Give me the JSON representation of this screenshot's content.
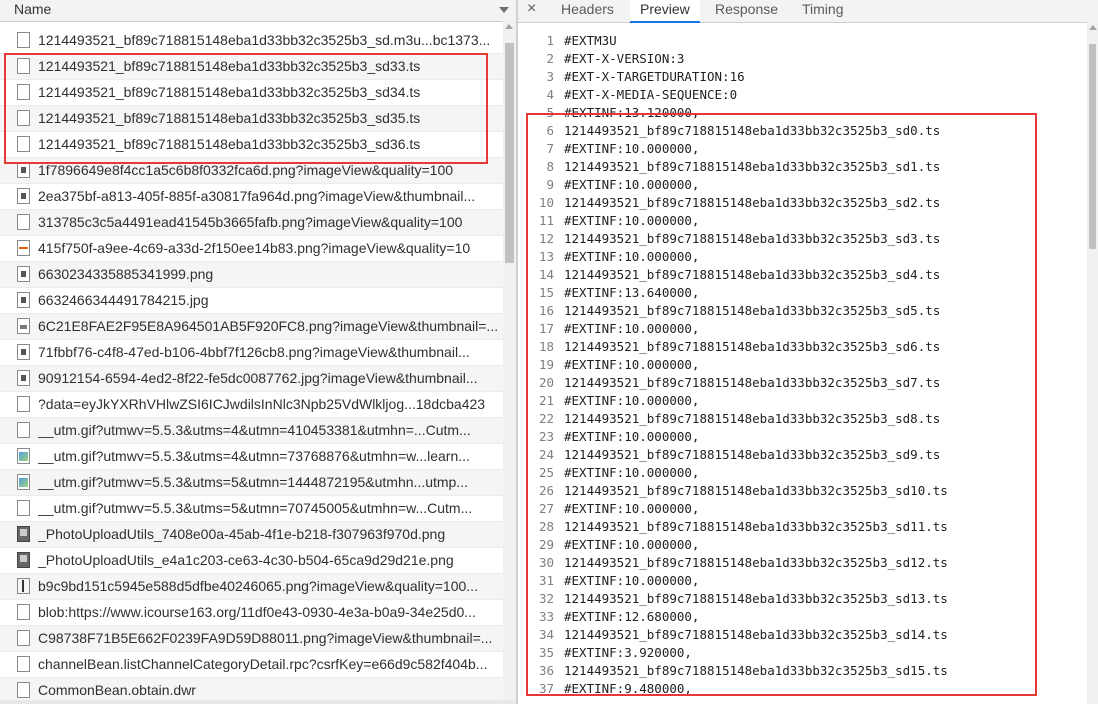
{
  "network": {
    "name_column_label": "Name",
    "requests": [
      {
        "name": "1214493521_bf89c718815148eba1d33bb32c3525b3_sd.m3u...bc1373...",
        "icon": "doc-icon"
      },
      {
        "name": "1214493521_bf89c718815148eba1d33bb32c3525b3_sd33.ts",
        "icon": "doc-icon"
      },
      {
        "name": "1214493521_bf89c718815148eba1d33bb32c3525b3_sd34.ts",
        "icon": "doc-icon"
      },
      {
        "name": "1214493521_bf89c718815148eba1d33bb32c3525b3_sd35.ts",
        "icon": "doc-icon"
      },
      {
        "name": "1214493521_bf89c718815148eba1d33bb32c3525b3_sd36.ts",
        "icon": "doc-icon"
      },
      {
        "name": "1f7896649e8f4cc1a5c6b8f0332fca6d.png?imageView&quality=100",
        "icon": "image-icon"
      },
      {
        "name": "2ea375bf-a813-405f-885f-a30817fa964d.png?imageView&thumbnail...",
        "icon": "image-icon"
      },
      {
        "name": "313785c3c5a4491ead41545b3665fafb.png?imageView&quality=100",
        "icon": "doc-icon"
      },
      {
        "name": "415f750f-a9ee-4c69-a33d-2f150ee14b83.png?imageView&quality=10",
        "icon": "orange-line-icon"
      },
      {
        "name": "6630234335885341999.png",
        "icon": "image-icon"
      },
      {
        "name": "6632466344491784215.jpg",
        "icon": "image-icon"
      },
      {
        "name": "6C21E8FAE2F95E8A964501AB5F920FC8.png?imageView&thumbnail=...",
        "icon": "thumbnail-icon"
      },
      {
        "name": "71fbbf76-c4f8-47ed-b106-4bbf7f126cb8.png?imageView&thumbnail...",
        "icon": "image-icon"
      },
      {
        "name": "90912154-6594-4ed2-8f22-fe5dc0087762.jpg?imageView&thumbnail...",
        "icon": "image-icon"
      },
      {
        "name": "?data=eyJkYXRhVHlwZSI6ICJwdilsInNlc3Npb25VdWlkljog...18dcba423",
        "icon": "doc-icon"
      },
      {
        "name": "__utm.gif?utmwv=5.5.3&utms=4&utmn=410453381&utmhn=...Cutm...",
        "icon": "doc-icon"
      },
      {
        "name": "__utm.gif?utmwv=5.5.3&utms=4&utmn=73768876&utmhn=w...learn...",
        "icon": "gif-icon"
      },
      {
        "name": "__utm.gif?utmwv=5.5.3&utms=5&utmn=1444872195&utmhn...utmp...",
        "icon": "gif-icon"
      },
      {
        "name": "__utm.gif?utmwv=5.5.3&utms=5&utmn=70745005&utmhn=w...Cutm...",
        "icon": "doc-icon"
      },
      {
        "name": "_PhotoUploadUtils_7408e00a-45ab-4f1e-b218-f307963f970d.png",
        "icon": "dark-image-icon"
      },
      {
        "name": "_PhotoUploadUtils_e4a1c203-ce63-4c30-b504-65ca9d29d21e.png",
        "icon": "dark-image-icon"
      },
      {
        "name": "b9c9bd151c5945e588d5dfbe40246065.png?imageView&quality=100...",
        "icon": "ruler-icon"
      },
      {
        "name": "blob:https://www.icourse163.org/11df0e43-0930-4e3a-b0a9-34e25d0...",
        "icon": "doc-icon"
      },
      {
        "name": "C98738F71B5E662F0239FA9D59D88011.png?imageView&thumbnail=...",
        "icon": "doc-icon"
      },
      {
        "name": "channelBean.listChannelCategoryDetail.rpc?csrfKey=e66d9c582f404b...",
        "icon": "doc-icon"
      },
      {
        "name": "CommonBean.obtain.dwr",
        "icon": "doc-icon"
      }
    ]
  },
  "detail": {
    "close_glyph": "×",
    "tabs": [
      "Headers",
      "Preview",
      "Response",
      "Timing"
    ],
    "active_tab": "Preview",
    "lines": [
      {
        "n": "1",
        "t": "#EXTM3U"
      },
      {
        "n": "2",
        "t": "#EXT-X-VERSION:3"
      },
      {
        "n": "3",
        "t": "#EXT-X-TARGETDURATION:16"
      },
      {
        "n": "4",
        "t": "#EXT-X-MEDIA-SEQUENCE:0"
      },
      {
        "n": "5",
        "t": "#EXTINF:13.120000,"
      },
      {
        "n": "6",
        "t": "1214493521_bf89c718815148eba1d33bb32c3525b3_sd0.ts"
      },
      {
        "n": "7",
        "t": "#EXTINF:10.000000,"
      },
      {
        "n": "8",
        "t": "1214493521_bf89c718815148eba1d33bb32c3525b3_sd1.ts"
      },
      {
        "n": "9",
        "t": "#EXTINF:10.000000,"
      },
      {
        "n": "10",
        "t": "1214493521_bf89c718815148eba1d33bb32c3525b3_sd2.ts"
      },
      {
        "n": "11",
        "t": "#EXTINF:10.000000,"
      },
      {
        "n": "12",
        "t": "1214493521_bf89c718815148eba1d33bb32c3525b3_sd3.ts"
      },
      {
        "n": "13",
        "t": "#EXTINF:10.000000,"
      },
      {
        "n": "14",
        "t": "1214493521_bf89c718815148eba1d33bb32c3525b3_sd4.ts"
      },
      {
        "n": "15",
        "t": "#EXTINF:13.640000,"
      },
      {
        "n": "16",
        "t": "1214493521_bf89c718815148eba1d33bb32c3525b3_sd5.ts"
      },
      {
        "n": "17",
        "t": "#EXTINF:10.000000,"
      },
      {
        "n": "18",
        "t": "1214493521_bf89c718815148eba1d33bb32c3525b3_sd6.ts"
      },
      {
        "n": "19",
        "t": "#EXTINF:10.000000,"
      },
      {
        "n": "20",
        "t": "1214493521_bf89c718815148eba1d33bb32c3525b3_sd7.ts"
      },
      {
        "n": "21",
        "t": "#EXTINF:10.000000,"
      },
      {
        "n": "22",
        "t": "1214493521_bf89c718815148eba1d33bb32c3525b3_sd8.ts"
      },
      {
        "n": "23",
        "t": "#EXTINF:10.000000,"
      },
      {
        "n": "24",
        "t": "1214493521_bf89c718815148eba1d33bb32c3525b3_sd9.ts"
      },
      {
        "n": "25",
        "t": "#EXTINF:10.000000,"
      },
      {
        "n": "26",
        "t": "1214493521_bf89c718815148eba1d33bb32c3525b3_sd10.ts"
      },
      {
        "n": "27",
        "t": "#EXTINF:10.000000,"
      },
      {
        "n": "28",
        "t": "1214493521_bf89c718815148eba1d33bb32c3525b3_sd11.ts"
      },
      {
        "n": "29",
        "t": "#EXTINF:10.000000,"
      },
      {
        "n": "30",
        "t": "1214493521_bf89c718815148eba1d33bb32c3525b3_sd12.ts"
      },
      {
        "n": "31",
        "t": "#EXTINF:10.000000,"
      },
      {
        "n": "32",
        "t": "1214493521_bf89c718815148eba1d33bb32c3525b3_sd13.ts"
      },
      {
        "n": "33",
        "t": "#EXTINF:12.680000,"
      },
      {
        "n": "34",
        "t": "1214493521_bf89c718815148eba1d33bb32c3525b3_sd14.ts"
      },
      {
        "n": "35",
        "t": "#EXTINF:3.920000,"
      },
      {
        "n": "36",
        "t": "1214493521_bf89c718815148eba1d33bb32c3525b3_sd15.ts"
      },
      {
        "n": "37",
        "t": "#EXTINF:9.480000,"
      }
    ]
  },
  "colors": {
    "highlight": "#e53935",
    "active_tab_underline": "#1a73e8"
  }
}
